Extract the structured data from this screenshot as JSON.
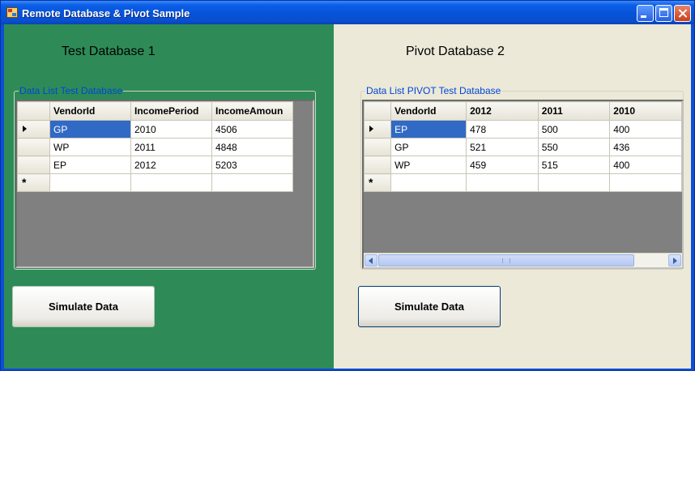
{
  "window": {
    "title": "Remote Database & Pivot Sample"
  },
  "left": {
    "heading": "Test Database 1",
    "group_label": "Data List Test Database",
    "columns": [
      "VendorId",
      "IncomePeriod",
      "IncomeAmoun"
    ],
    "rows": [
      [
        "GP",
        "2010",
        "4506"
      ],
      [
        "WP",
        "2011",
        "4848"
      ],
      [
        "EP",
        "2012",
        "5203"
      ]
    ],
    "button": "Simulate Data"
  },
  "right": {
    "heading": "Pivot Database 2",
    "group_label": "Data List PIVOT Test Database",
    "columns": [
      "VendorId",
      "2012",
      "2011",
      "2010"
    ],
    "rows": [
      [
        "EP",
        "478",
        "500",
        "400"
      ],
      [
        "GP",
        "521",
        "550",
        "436"
      ],
      [
        "WP",
        "459",
        "515",
        "400"
      ]
    ],
    "button": "Simulate Data"
  },
  "new_row_marker": "*",
  "colors": {
    "left_panel": "#2e8b57",
    "selection": "#316ac5",
    "legend": "#0046d5"
  }
}
